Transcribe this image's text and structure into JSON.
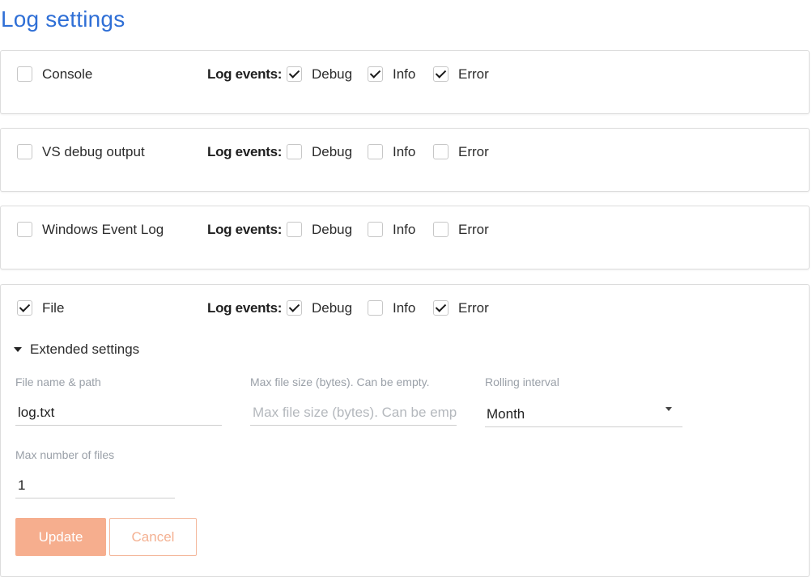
{
  "page": {
    "title": "Log settings"
  },
  "log_events_label": "Log events:",
  "levels": {
    "debug": "Debug",
    "info": "Info",
    "error": "Error"
  },
  "sinks": [
    {
      "name": "Console",
      "enabled": false,
      "debug": true,
      "info": true,
      "error": true
    },
    {
      "name": "VS debug output",
      "enabled": false,
      "debug": false,
      "info": false,
      "error": false
    },
    {
      "name": "Windows Event Log",
      "enabled": false,
      "debug": false,
      "info": false,
      "error": false
    },
    {
      "name": "File",
      "enabled": true,
      "debug": true,
      "info": false,
      "error": true
    }
  ],
  "extended": {
    "toggle_label": "Extended settings",
    "expanded": true,
    "file_path": {
      "label": "File name & path",
      "value": "log.txt"
    },
    "max_size": {
      "label": "Max file size (bytes). Can be empty.",
      "value": "",
      "placeholder": "Max file size (bytes). Can be empty."
    },
    "rolling": {
      "label": "Rolling interval",
      "value": "Month"
    },
    "max_files": {
      "label": "Max number of files",
      "value": "1"
    }
  },
  "buttons": {
    "update": "Update",
    "cancel": "Cancel"
  },
  "colors": {
    "title": "#2f6fd6",
    "update_bg": "#f6ae8e",
    "cancel_text": "#f4b192"
  }
}
